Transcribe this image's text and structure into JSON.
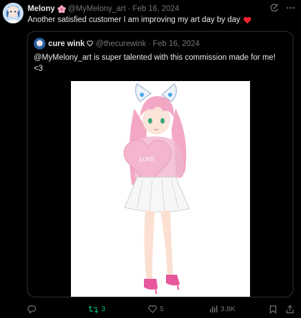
{
  "post": {
    "display_name": "Melony",
    "handle": "@MyMelony_art",
    "date": "Feb 16, 2024",
    "text": "Another satisfied customer I am improving my art day by day",
    "name_icon": "flower-icon",
    "text_emoji": "red-heart-icon"
  },
  "quoted": {
    "display_name": "cure wink",
    "name_icon": "small-heart-icon",
    "handle": "@thecurewink",
    "date": "Feb 16, 2024",
    "text": "@MyMelony_art is super talented with this commission made for me! <3",
    "heart_label": "LOVE"
  },
  "actions": {
    "reply_count": "",
    "retweet_count": "3",
    "like_count": "5",
    "views_count": "3.8K"
  },
  "colors": {
    "background": "#000000",
    "text": "#e7e9ea",
    "muted": "#71767b",
    "border": "#2f3336",
    "retweet_active": "#00ba7c",
    "heart_emoji": "#f4212e",
    "flower": "#f7a8c4"
  }
}
